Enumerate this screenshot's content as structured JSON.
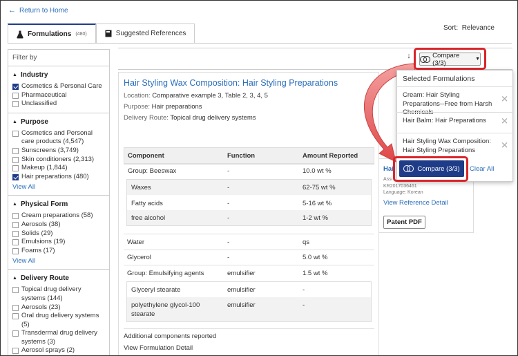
{
  "nav": {
    "return_label": "Return to Home"
  },
  "tabs": [
    {
      "label": "Formulations",
      "count": "(480)"
    },
    {
      "label": "Suggested References"
    }
  ],
  "sort": {
    "label": "Sort:",
    "value": "Relevance"
  },
  "filters": {
    "header": "Filter by",
    "sections": [
      {
        "title": "Industry",
        "options": [
          {
            "label": "Cosmetics & Personal Care",
            "checked": true
          },
          {
            "label": "Pharmaceutical",
            "checked": false
          },
          {
            "label": "Unclassified",
            "checked": false
          }
        ]
      },
      {
        "title": "Purpose",
        "options": [
          {
            "label": "Cosmetics and Personal care products (4,547)",
            "checked": false
          },
          {
            "label": "Sunscreens (3,749)",
            "checked": false
          },
          {
            "label": "Skin conditioners (2,313)",
            "checked": false
          },
          {
            "label": "Makeup (1,844)",
            "checked": false
          },
          {
            "label": "Hair preparations (480)",
            "checked": true
          }
        ],
        "view_all": "View All"
      },
      {
        "title": "Physical Form",
        "options": [
          {
            "label": "Cream preparations (58)",
            "checked": false
          },
          {
            "label": "Aerosols (38)",
            "checked": false
          },
          {
            "label": "Solids (29)",
            "checked": false
          },
          {
            "label": "Emulsions (19)",
            "checked": false
          },
          {
            "label": "Foams (17)",
            "checked": false
          }
        ],
        "view_all": "View All"
      },
      {
        "title": "Delivery Route",
        "options": [
          {
            "label": "Topical drug delivery systems (144)",
            "checked": false
          },
          {
            "label": "Aerosols (23)",
            "checked": false
          },
          {
            "label": "Oral drug delivery systems (5)",
            "checked": false
          },
          {
            "label": "Transdermal drug delivery systems (3)",
            "checked": false
          },
          {
            "label": "Aerosol sprays (2)",
            "checked": false
          }
        ]
      }
    ]
  },
  "result": {
    "title": "Hair Styling Wax Composition: Hair Styling Preparations",
    "location_label": "Location:",
    "location": "Comparative example 3, Table 2, 3, 4, 5",
    "purpose_label": "Purpose:",
    "purpose": "Hair preparations",
    "route_label": "Delivery Route:",
    "route": "Topical drug delivery systems",
    "table": {
      "headers": [
        "Component",
        "Function",
        "Amount Reported"
      ],
      "rows": [
        {
          "component": "Group: Beeswax",
          "function": "-",
          "amount": "10.0 wt %"
        },
        {
          "component": "Waxes",
          "function": "-",
          "amount": "62-75 wt %"
        },
        {
          "component": "Fatty acids",
          "function": "-",
          "amount": "5-16 wt %"
        },
        {
          "component": "free alcohol",
          "function": "-",
          "amount": "1-2 wt %"
        },
        {
          "component": "Water",
          "function": "-",
          "amount": "qs"
        },
        {
          "component": "Glycerol",
          "function": "-",
          "amount": "5.0 wt %"
        },
        {
          "component": "Group: Emulsifying agents",
          "function": "emulsifier",
          "amount": "1.5 wt %"
        },
        {
          "component": "Glyceryl stearate",
          "function": "emulsifier",
          "amount": "-"
        },
        {
          "component": "polyethylene glycol-100 stearate",
          "function": "emulsifier",
          "amount": "-"
        }
      ]
    },
    "additional_note": "Additional components reported",
    "view_detail": "View Formulation Detail"
  },
  "reference": {
    "title_fragment": "Hai",
    "assignee_fragment": "Assi",
    "number": "KR2017036461",
    "language": "Language: Korean",
    "view_detail": "View Reference Detail",
    "pdf_button": "Patent PDF"
  },
  "compare": {
    "button_label": "Compare (3/3)",
    "dropdown_title": "Selected Formulations",
    "items": [
      "Cream: Hair Styling Preparations--Free from Harsh Chemicals",
      "Hair Balm: Hair Preparations",
      "Hair Styling Wax Composition: Hair Styling Preparations"
    ],
    "action_label": "Compare (3/3)",
    "clear_label": "Clear All"
  },
  "colors": {
    "accent": "#1f3c88",
    "link": "#2a6ebb",
    "highlight": "#d9252a"
  }
}
